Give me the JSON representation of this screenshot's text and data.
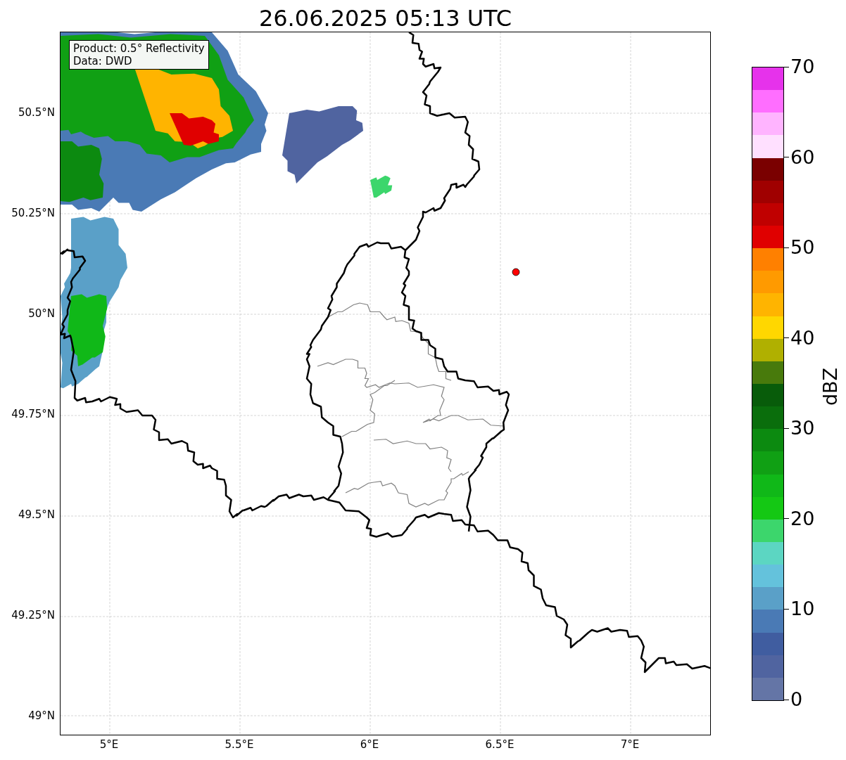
{
  "title": "26.06.2025 05:13 UTC",
  "info_box": [
    "Product: 0.5° Reflectivity",
    "Data: DWD"
  ],
  "y_ticks": [
    "50.5°N",
    "50.25°N",
    "50°N",
    "49.75°N",
    "49.5°N",
    "49.25°N",
    "49°N"
  ],
  "x_ticks": [
    "5°E",
    "5.5°E",
    "6°E",
    "6.5°E",
    "7°E"
  ],
  "colorbar": {
    "label": "dBZ",
    "ticks": [
      "70",
      "60",
      "50",
      "40",
      "30",
      "20",
      "10",
      "0"
    ],
    "segments": [
      {
        "color": "#e632eb"
      },
      {
        "color": "#ff6eff"
      },
      {
        "color": "#ffb4ff"
      },
      {
        "color": "#ffe0ff"
      },
      {
        "color": "#7a0000"
      },
      {
        "color": "#a00000"
      },
      {
        "color": "#c00000"
      },
      {
        "color": "#e00000"
      },
      {
        "color": "#ff8000"
      },
      {
        "color": "#ff9a00"
      },
      {
        "color": "#ffb400"
      },
      {
        "color": "#ffd700"
      },
      {
        "color": "#b0b000"
      },
      {
        "color": "#487a0c"
      },
      {
        "color": "#085c0a"
      },
      {
        "color": "#0a6e0c"
      },
      {
        "color": "#0c8a10"
      },
      {
        "color": "#10a014"
      },
      {
        "color": "#10b818"
      },
      {
        "color": "#14c814"
      },
      {
        "color": "#3cd66c"
      },
      {
        "color": "#5cd6c2"
      },
      {
        "color": "#64c2dc"
      },
      {
        "color": "#5aa0c8"
      },
      {
        "color": "#4a7ab5"
      },
      {
        "color": "#405da0"
      },
      {
        "color": "#5064a0"
      },
      {
        "color": "#6475a6"
      }
    ]
  }
}
